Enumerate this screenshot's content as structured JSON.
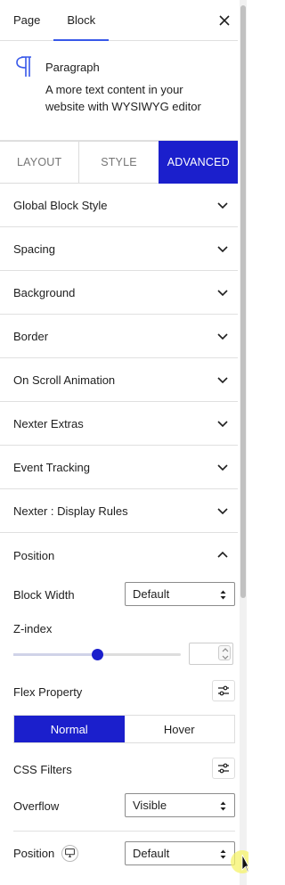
{
  "header": {
    "tabs": [
      {
        "label": "Page"
      },
      {
        "label": "Block"
      }
    ],
    "close_icon": "close-icon"
  },
  "block": {
    "icon": "paragraph-icon",
    "title": "Paragraph",
    "description": "A more text content in your website with WYSIWYG editor"
  },
  "settings_tabs": [
    {
      "label": "LAYOUT"
    },
    {
      "label": "STYLE"
    },
    {
      "label": "ADVANCED"
    }
  ],
  "panels": [
    {
      "label": "Global Block Style"
    },
    {
      "label": "Spacing"
    },
    {
      "label": "Background"
    },
    {
      "label": "Border"
    },
    {
      "label": "On Scroll Animation"
    },
    {
      "label": "Nexter Extras"
    },
    {
      "label": "Event Tracking"
    },
    {
      "label": "Nexter : Display Rules"
    }
  ],
  "position_section": {
    "title": "Position",
    "block_width_label": "Block Width",
    "block_width_value": "Default",
    "zindex_label": "Z-index",
    "zindex_slider_fraction": 0.5,
    "zindex_value": "",
    "flex_label": "Flex Property",
    "state_toggle": [
      {
        "label": "Normal"
      },
      {
        "label": "Hover"
      }
    ],
    "css_filters_label": "CSS Filters",
    "overflow_label": "Overflow",
    "overflow_value": "Visible",
    "position_label": "Position",
    "position_value": "Default"
  },
  "colors": {
    "accent": "#1b1fcc",
    "tab_underline": "#3858e9"
  }
}
